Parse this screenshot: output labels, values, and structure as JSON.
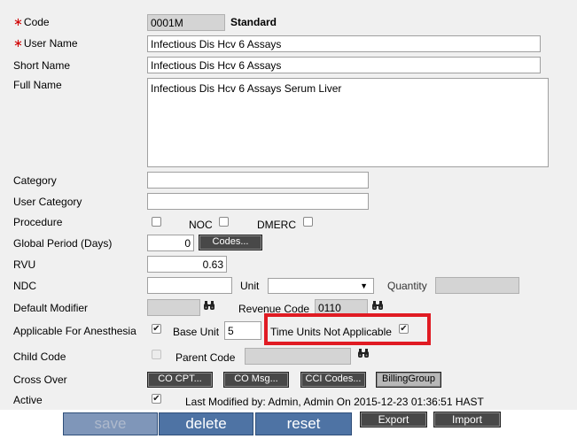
{
  "form": {
    "code_label": "Code",
    "code_value": "0001M",
    "standard_label": "Standard",
    "user_name_label": "User Name",
    "user_name_value": "Infectious Dis Hcv 6 Assays",
    "short_name_label": "Short Name",
    "short_name_value": "Infectious Dis Hcv 6 Assays",
    "full_name_label": "Full Name",
    "full_name_value": "Infectious Dis Hcv 6 Assays Serum Liver",
    "category_label": "Category",
    "user_category_label": "User Category",
    "procedure_label": "Procedure",
    "noc_label": "NOC",
    "dmerc_label": "DMERC",
    "global_period_label": "Global Period (Days)",
    "global_period_value": "0",
    "codes_button": "Codes...",
    "rvu_label": "RVU",
    "rvu_value": "0.63",
    "ndc_label": "NDC",
    "unit_label": "Unit",
    "quantity_label": "Quantity",
    "default_modifier_label": "Default Modifier",
    "revenue_code_label": "Revenue Code",
    "revenue_code_value": "0110",
    "anesthesia_label": "Applicable For Anesthesia",
    "base_unit_label": "Base Unit",
    "base_unit_value": "5",
    "time_units_label": "Time Units Not Applicable",
    "child_code_label": "Child Code",
    "parent_code_label": "Parent Code",
    "cross_over_label": "Cross Over",
    "co_cpt_button": "CO CPT...",
    "co_msg_button": "CO Msg...",
    "cci_codes_button": "CCI Codes...",
    "billing_group_button": "BillingGroup",
    "active_label": "Active",
    "last_modified_text": "Last Modified by: Admin, Admin On 2015-12-23 01:36:51 HAST",
    "checkmark": "✔"
  },
  "footer": {
    "save_label": "save",
    "delete_label": "delete",
    "reset_label": "reset",
    "export_label": "Export",
    "import_label": "Import"
  },
  "colors": {
    "required_marker": "#d00000",
    "highlight_box": "#e01b23",
    "footer_button": "#4e73a4"
  }
}
